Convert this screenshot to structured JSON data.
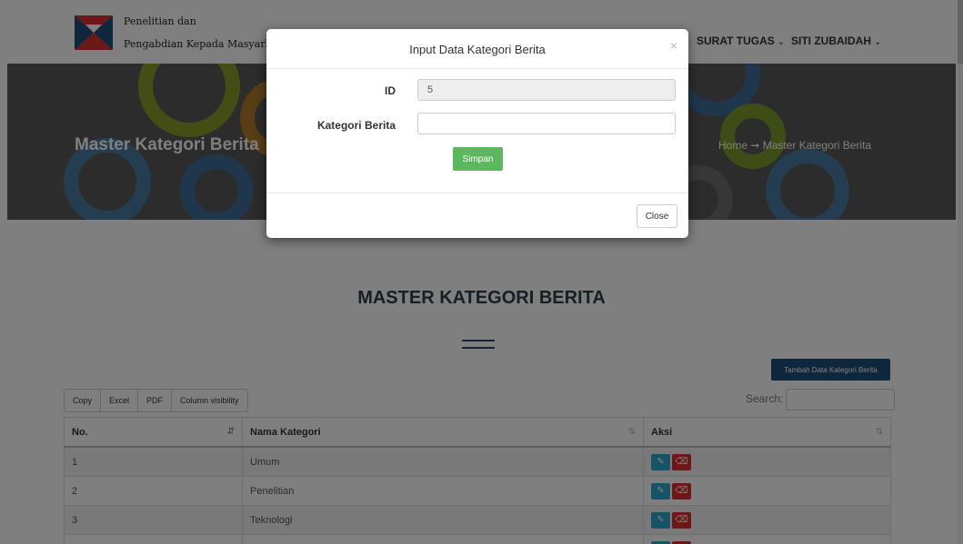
{
  "logo": {
    "line1": "Penelitian dan",
    "line2": "Pengabdian Kepada Masyarkat"
  },
  "nav": {
    "items": [
      {
        "label": "SURAT TUGAS"
      },
      {
        "label": "SITI ZUBAIDAH"
      }
    ]
  },
  "hero": {
    "title": "Master Kategori Berita",
    "breadcrumb": "Home ➞ Master Kategori Berita"
  },
  "section": {
    "title": "MASTER KATEGORI BERITA"
  },
  "toolbar": {
    "add_label": "Tambah Data Kategori Berita",
    "exports": [
      "Copy",
      "Excel",
      "PDF",
      "Column visibility"
    ],
    "search_label": "Search:",
    "search_value": ""
  },
  "table": {
    "columns": [
      "No.",
      "Nama Kategori",
      "Aksi"
    ],
    "rows": [
      {
        "no": "1",
        "nama": "Umum"
      },
      {
        "no": "2",
        "nama": "Penelitian"
      },
      {
        "no": "3",
        "nama": "Teknologi"
      },
      {
        "no": "",
        "nama": ""
      }
    ]
  },
  "modal": {
    "title": "Input Data Kategori Berita",
    "close_icon": "×",
    "id_label": "ID",
    "id_value": "5",
    "kategori_label": "Kategori Berita",
    "kategori_value": "",
    "save_label": "Simpan",
    "close_label": "Close"
  },
  "colors": {
    "primary": "#1f4e79",
    "success": "#5cb85c",
    "info": "#2fa4cf",
    "danger": "#d9302f",
    "hero_bg": "#58585a"
  },
  "icons": {
    "edit": "edit-icon",
    "delete": "eraser-icon",
    "sort_active": "sort-asc-icon",
    "sort": "sort-icon",
    "chevron": "chevron-down-icon"
  }
}
